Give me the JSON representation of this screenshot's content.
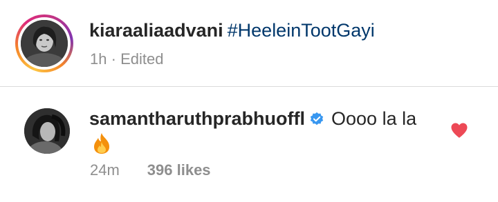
{
  "caption": {
    "username": "kiaraaliaadvani",
    "hashtag": "#HeeleinTootGayi",
    "time": "1h",
    "separator": "·",
    "edited_label": "Edited"
  },
  "comment": {
    "username": "samantharuthprabhuoffl",
    "text": "Oooo la la",
    "time": "24m",
    "likes": "396 likes",
    "liked": true
  },
  "icons": {
    "verified": "verified-badge-icon",
    "heart": "heart-icon",
    "fire_emoji": "fire-emoji-icon"
  },
  "colors": {
    "username": "#262626",
    "hashtag": "#00376b",
    "meta": "#8e8e8e",
    "verified": "#3897f0",
    "heart": "#ed4956",
    "divider": "#dbdbdb"
  }
}
